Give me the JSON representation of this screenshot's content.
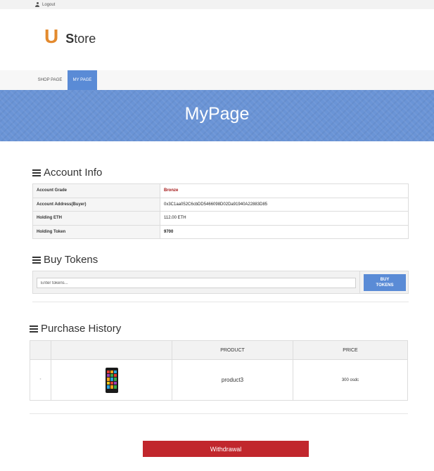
{
  "topbar": {
    "logout_label": "Logout"
  },
  "logo": {
    "letter": "U",
    "store_first": "S",
    "store_rest": "tore"
  },
  "nav": {
    "items": [
      {
        "label": "SHOP PAGE"
      },
      {
        "label": "MY PAGE"
      }
    ]
  },
  "banner": {
    "title": "MyPage"
  },
  "account": {
    "title": "Account Info",
    "rows": [
      {
        "label": "Account Grade",
        "value": "Bronze"
      },
      {
        "label": "Account Address(Buyer)",
        "value": "0x3C1aa052C6cbDD5466098D02Da91940A22883D85"
      },
      {
        "label": "Holding ETH",
        "value": "112.00 ETH"
      },
      {
        "label": "Holding Token",
        "value": "9700"
      }
    ]
  },
  "buy": {
    "title": "Buy Tokens",
    "placeholder": "Enter tokens...",
    "button_line1": "BUY",
    "button_line2": "TOKENS"
  },
  "history": {
    "title": "Purchase History",
    "columns": [
      "",
      "",
      "PRODUCT",
      "PRICE"
    ],
    "rows": [
      {
        "index": "°",
        "product": "product3",
        "price": "300 osdc"
      }
    ]
  },
  "withdraw": {
    "label": "Withdrawal"
  },
  "colors": {
    "accent": "#5a8bd6",
    "logo_orange": "#e38a2e",
    "withdraw_red": "#c1272d",
    "grade_red": "#a31515"
  }
}
